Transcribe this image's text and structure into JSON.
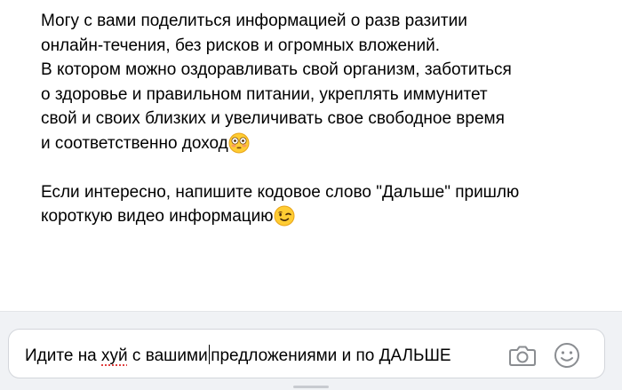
{
  "message": {
    "paragraph1_lines": [
      "Могу с вами поделиться информацией о разв разитии",
      "онлайн-течения, без рисков и огромных вложений.",
      "В котором можно оздоравливать свой организм, заботиться",
      "о здоровье и правильном питании, укреплять иммунитет",
      "свой и своих близких и увеличивать свое свободное время",
      "и соответственно доход"
    ],
    "paragraph2_lines": [
      "Если интересно, напишите кодовое слово \"Дальше\" пришлю",
      "короткую видео информацию"
    ],
    "emoji1": "flushed-face-emoji",
    "emoji2": "winking-face-emoji"
  },
  "composer": {
    "text_part1": "Идите на ",
    "text_misspelled": "хуй",
    "text_part2": " с вашими",
    "text_part3": "предложениями и по ДАЛЬШЕ",
    "camera_icon": "camera-icon",
    "emoji_icon": "smiley-icon"
  },
  "colors": {
    "background": "#ffffff",
    "composer_bar": "#f0f2f5",
    "icon_gray": "#8a8d91",
    "spellcheck_red": "#e04040"
  }
}
